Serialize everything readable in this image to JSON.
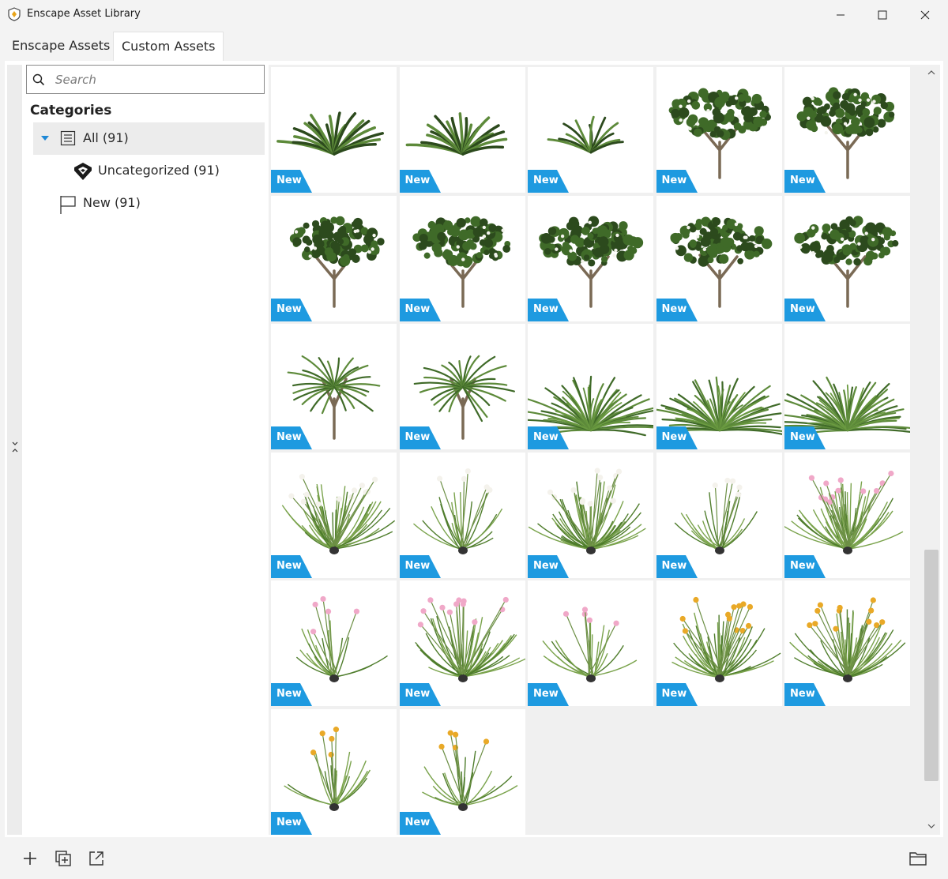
{
  "window": {
    "title": "Enscape Asset Library"
  },
  "tabs": [
    {
      "label": "Enscape Assets"
    },
    {
      "label": "Custom Assets"
    }
  ],
  "search": {
    "placeholder": "Search"
  },
  "categories": {
    "title": "Categories",
    "items": [
      {
        "label": "All (91)",
        "icon": "list-icon",
        "expanded": true,
        "selected": true
      },
      {
        "label": "Uncategorized (91)",
        "icon": "enscape-logo-icon"
      },
      {
        "label": "New (91)",
        "icon": "flag-icon"
      }
    ]
  },
  "badge_label": "New",
  "colors": {
    "accent": "#1e9ae0",
    "badge_text": "#ffffff",
    "foliage_dark": "#2c4a1d",
    "foliage_light": "#5d8a3a"
  },
  "assets": [
    {
      "badge": "New",
      "kind": "fern"
    },
    {
      "badge": "New",
      "kind": "fern"
    },
    {
      "badge": "New",
      "kind": "fern-small"
    },
    {
      "badge": "New",
      "kind": "tree"
    },
    {
      "badge": "New",
      "kind": "tree"
    },
    {
      "badge": "New",
      "kind": "tree"
    },
    {
      "badge": "New",
      "kind": "tree"
    },
    {
      "badge": "New",
      "kind": "tree"
    },
    {
      "badge": "New",
      "kind": "tree"
    },
    {
      "badge": "New",
      "kind": "tree"
    },
    {
      "badge": "New",
      "kind": "palm"
    },
    {
      "badge": "New",
      "kind": "palm"
    },
    {
      "badge": "New",
      "kind": "bush"
    },
    {
      "badge": "New",
      "kind": "bush"
    },
    {
      "badge": "New",
      "kind": "bush"
    },
    {
      "badge": "New",
      "kind": "lily-white"
    },
    {
      "badge": "New",
      "kind": "lily-white-sparse"
    },
    {
      "badge": "New",
      "kind": "lily-white"
    },
    {
      "badge": "New",
      "kind": "lily-white-sparse"
    },
    {
      "badge": "New",
      "kind": "lily-pink"
    },
    {
      "badge": "New",
      "kind": "lily-pink-sparse"
    },
    {
      "badge": "New",
      "kind": "lily-pink"
    },
    {
      "badge": "New",
      "kind": "lily-pink-sparse"
    },
    {
      "badge": "New",
      "kind": "lily-yellow"
    },
    {
      "badge": "New",
      "kind": "lily-yellow"
    },
    {
      "badge": "New",
      "kind": "lily-yellow-sparse"
    },
    {
      "badge": "New",
      "kind": "lily-yellow-sparse"
    }
  ]
}
